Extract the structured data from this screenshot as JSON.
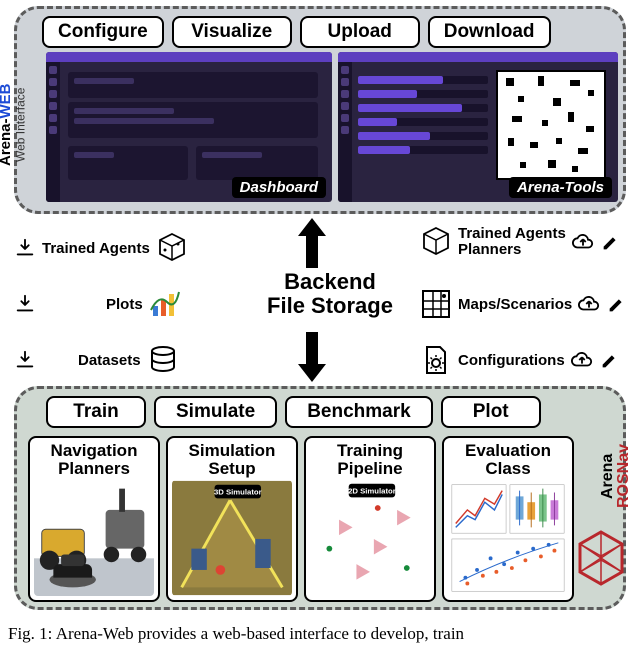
{
  "top_buttons": [
    "Configure",
    "Visualize",
    "Upload",
    "Download"
  ],
  "bottom_buttons": [
    "Train",
    "Simulate",
    "Benchmark",
    "Plot"
  ],
  "web_label": {
    "brand1": "Arena-",
    "brand2": "WEB",
    "sub": "Web Interface"
  },
  "ros_label": {
    "l1": "Arena",
    "l2": "ROSNav"
  },
  "shots": {
    "dashboard": "Dashboard",
    "tools": "Arena-Tools"
  },
  "backend": {
    "l1": "Backend",
    "l2": "File Storage"
  },
  "left_items": [
    {
      "label": "Trained Agents"
    },
    {
      "label": "Plots"
    },
    {
      "label": "Datasets"
    }
  ],
  "right_items": [
    {
      "l1": "Trained Agents",
      "l2": "Planners"
    },
    {
      "l1": "Maps/Scenarios",
      "l2": ""
    },
    {
      "l1": "Configurations",
      "l2": ""
    }
  ],
  "cards": [
    {
      "t1": "Navigation",
      "t2": "Planners"
    },
    {
      "t1": "Simulation",
      "t2": "Setup",
      "badge": "3D Simulator"
    },
    {
      "t1": "Training",
      "t2": "Pipeline",
      "badge": "2D Simulator"
    },
    {
      "t1": "Evaluation",
      "t2": "Class"
    }
  ],
  "caption": "Fig. 1: Arena-Web provides a web-based interface to develop, train"
}
